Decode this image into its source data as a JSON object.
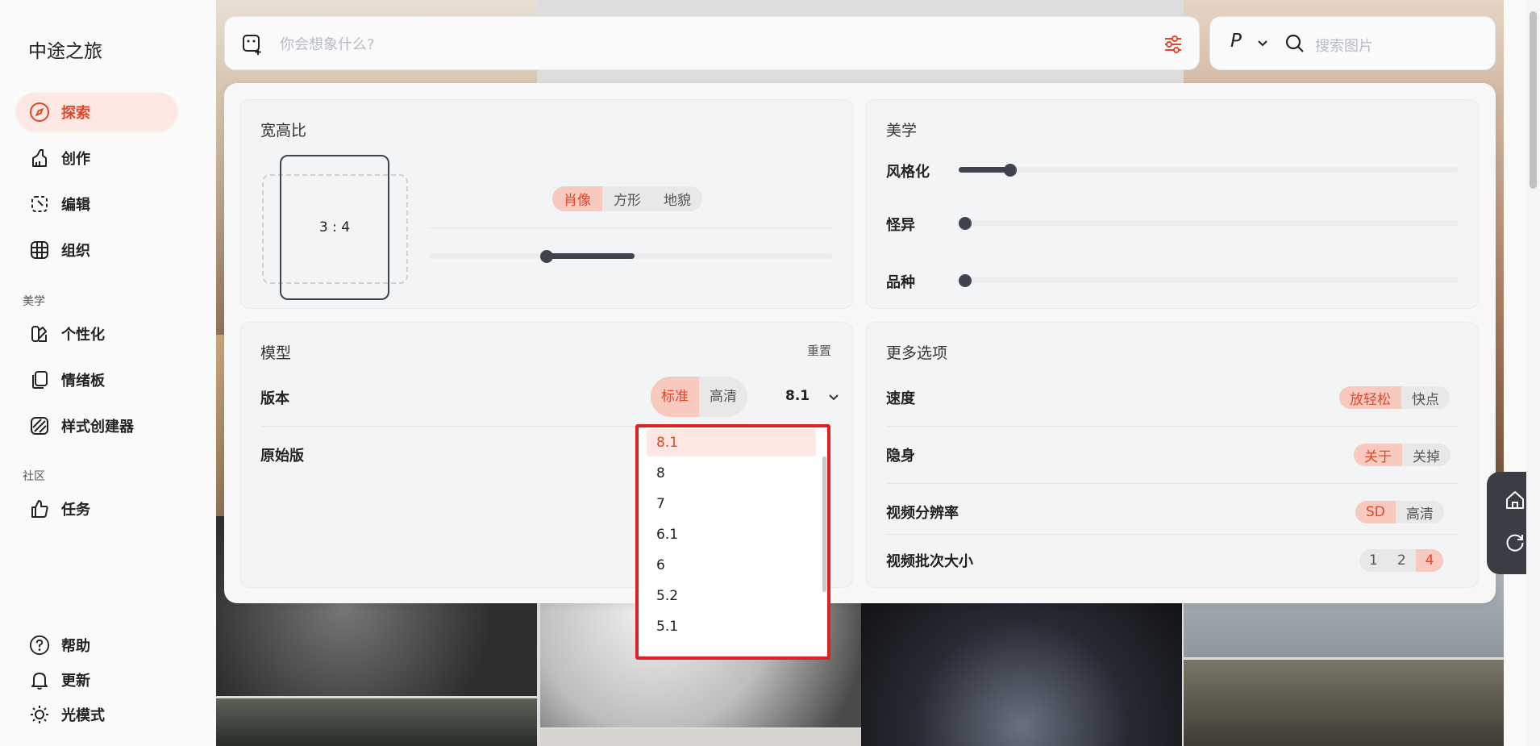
{
  "app": {
    "title": "中途之旅"
  },
  "sidebar": {
    "items": [
      {
        "label": "探索",
        "icon": "compass-icon"
      },
      {
        "label": "创作",
        "icon": "brush-icon"
      },
      {
        "label": "编辑",
        "icon": "edit-select-icon"
      },
      {
        "label": "组织",
        "icon": "grid-icon"
      }
    ],
    "section_aesthetics": "美学",
    "aesthetic_items": [
      {
        "label": "个性化",
        "icon": "personalize-icon"
      },
      {
        "label": "情绪板",
        "icon": "moodboard-icon"
      },
      {
        "label": "样式创建器",
        "icon": "style-creator-icon"
      }
    ],
    "section_community": "社区",
    "community_items": [
      {
        "label": "任务",
        "icon": "thumbs-up-icon"
      }
    ],
    "bottom_items": [
      {
        "label": "帮助",
        "icon": "help-icon"
      },
      {
        "label": "更新",
        "icon": "bell-icon"
      },
      {
        "label": "光模式",
        "icon": "sun-icon"
      }
    ]
  },
  "prompt": {
    "placeholder": "你会想象什么?"
  },
  "search": {
    "mode": "P",
    "placeholder": "搜索图片"
  },
  "aspect": {
    "title": "宽高比",
    "ratio": "3 : 4",
    "options": [
      "肖像",
      "方形",
      "地貌"
    ],
    "selected": "肖像"
  },
  "aesthetics": {
    "title": "美学",
    "sliders": [
      {
        "label": "风格化",
        "value": 0.1
      },
      {
        "label": "怪异",
        "value": 0
      },
      {
        "label": "品种",
        "value": 0
      }
    ]
  },
  "model": {
    "title": "模型",
    "reset": "重置",
    "version_label": "版本",
    "mode_options": [
      "标准",
      "高清"
    ],
    "mode_selected": "标准",
    "version_value": "8.1",
    "raw_label": "原始版",
    "versions": [
      "8.1",
      "8",
      "7",
      "6.1",
      "6",
      "5.2",
      "5.1"
    ]
  },
  "more": {
    "title": "更多选项",
    "rows": [
      {
        "label": "速度",
        "options": [
          "放轻松",
          "快点"
        ],
        "selected": "放轻松"
      },
      {
        "label": "隐身",
        "options": [
          "关于",
          "关掉"
        ],
        "selected": "关于"
      },
      {
        "label": "视频分辨率",
        "options": [
          "SD",
          "高清"
        ],
        "selected": "SD"
      },
      {
        "label": "视频批次大小",
        "options": [
          "1",
          "2",
          "4"
        ],
        "selected": "4"
      }
    ]
  },
  "colors": {
    "accent": "#e0482b",
    "accent_bg": "#fde7e3",
    "highlight": "#e02020"
  }
}
